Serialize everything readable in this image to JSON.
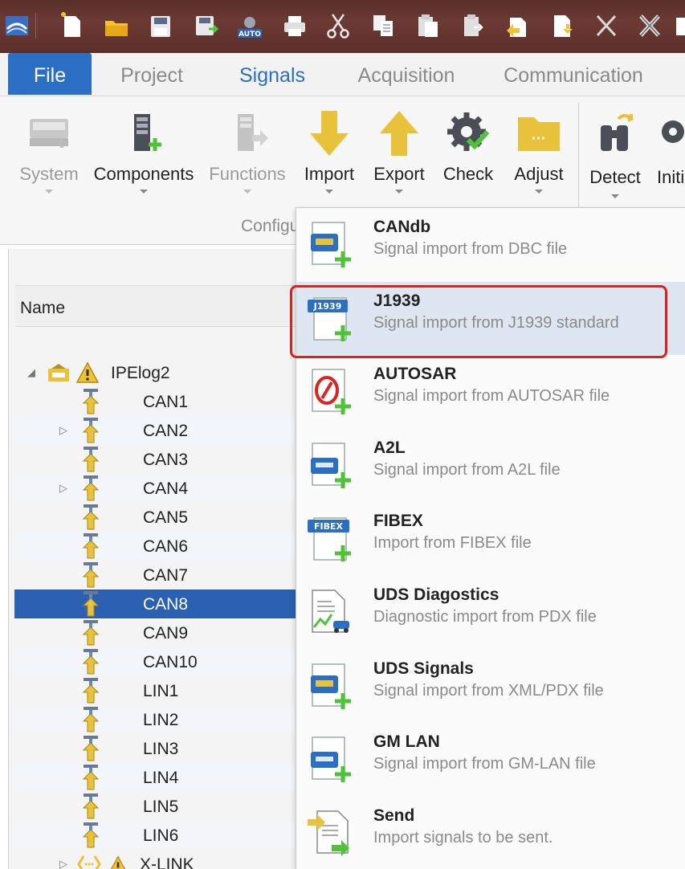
{
  "toolbar": {
    "icons": [
      "app-logo-icon",
      "new-document-icon",
      "open-folder-icon",
      "save-icon",
      "save-as-icon",
      "auto-icon",
      "print-icon",
      "cut-icon",
      "copy-icon",
      "paste-icon",
      "paste-special-icon",
      "add-item-icon",
      "add-file-icon",
      "delete-icon",
      "remove-icon"
    ],
    "auto_label": "AUTO"
  },
  "tabs": [
    {
      "label": "File"
    },
    {
      "label": "Project"
    },
    {
      "label": "Signals"
    },
    {
      "label": "Acquisition"
    },
    {
      "label": "Communication"
    }
  ],
  "ribbon": {
    "buttons": [
      {
        "label": "System",
        "enabled": false
      },
      {
        "label": "Components",
        "enabled": true
      },
      {
        "label": "Functions",
        "enabled": false
      },
      {
        "label": "Import",
        "enabled": true
      },
      {
        "label": "Export",
        "enabled": true
      },
      {
        "label": "Check",
        "enabled": true
      },
      {
        "label": "Adjust",
        "enabled": true
      },
      {
        "label": "Detect",
        "enabled": true
      },
      {
        "label": "Initi",
        "enabled": true
      }
    ],
    "group_label": "Configu"
  },
  "tree": {
    "column_header": "Name",
    "root": "IPElog2",
    "items": [
      "CAN1",
      "CAN2",
      "CAN3",
      "CAN4",
      "CAN5",
      "CAN6",
      "CAN7",
      "CAN8",
      "CAN9",
      "CAN10",
      "LIN1",
      "LIN2",
      "LIN3",
      "LIN4",
      "LIN5",
      "LIN6"
    ],
    "last": "X-LINK",
    "selected": "CAN8"
  },
  "import_menu": {
    "items": [
      {
        "title": "CANdb",
        "desc": "Signal import from DBC file",
        "icon": "dbc-import-icon"
      },
      {
        "title": "J1939",
        "desc": "Signal import from J1939 standard",
        "icon": "j1939-import-icon",
        "badge": "J1939"
      },
      {
        "title": "AUTOSAR",
        "desc": "Signal import from AUTOSAR file",
        "icon": "autosar-import-icon"
      },
      {
        "title": "A2L",
        "desc": "Signal import from A2L file",
        "icon": "a2l-import-icon"
      },
      {
        "title": "FIBEX",
        "desc": "Import from FIBEX file",
        "icon": "fibex-import-icon",
        "badge": "FIBEX"
      },
      {
        "title": "UDS Diagostics",
        "desc": "Diagnostic import from PDX file",
        "icon": "pdx-import-icon"
      },
      {
        "title": "UDS Signals",
        "desc": "Signal import from XML/PDX file",
        "icon": "uds-signals-import-icon"
      },
      {
        "title": "GM LAN",
        "desc": "Signal import from GM-LAN file",
        "icon": "gmlan-import-icon"
      },
      {
        "title": "Send",
        "desc": "Import signals to be sent.",
        "icon": "send-import-icon"
      }
    ]
  },
  "colors": {
    "accent": "#2b6fc4",
    "selection": "#2b5fb0",
    "highlight_box": "#e0201c",
    "titlebar": "#5a2f2a"
  }
}
